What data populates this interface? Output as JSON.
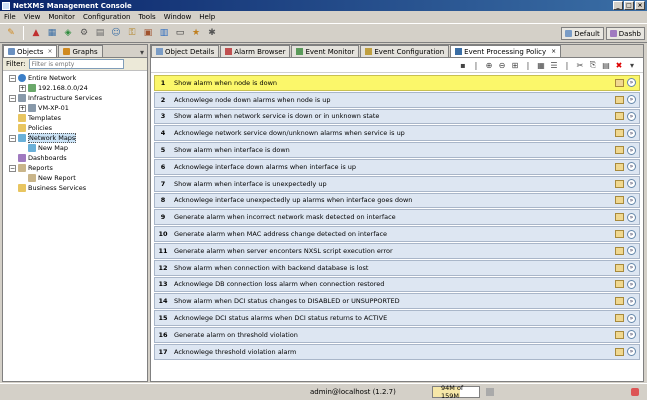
{
  "window": {
    "title": "NetXMS Management Console"
  },
  "menu": [
    "File",
    "View",
    "Monitor",
    "Configuration",
    "Tools",
    "Window",
    "Help"
  ],
  "perspectives": {
    "default_label": "Default",
    "dashboard_label": "Dashb"
  },
  "left_panel": {
    "tabs": [
      {
        "label": "Objects"
      },
      {
        "label": "Graphs"
      }
    ],
    "filter_label": "Filter:",
    "filter_placeholder": "Filter is empty",
    "tree": [
      {
        "label": "Entire Network",
        "level": 0,
        "icon": "globe-icon",
        "expander": "−"
      },
      {
        "label": "192.168.0.0/24",
        "level": 1,
        "icon": "subnet-icon",
        "expander": "+"
      },
      {
        "label": "Infrastructure Services",
        "level": 0,
        "icon": "server-icon",
        "expander": "−"
      },
      {
        "label": "VM-XP-01",
        "level": 1,
        "icon": "node-icon",
        "expander": "+"
      },
      {
        "label": "Templates",
        "level": 0,
        "icon": "folder-icon",
        "expander": ""
      },
      {
        "label": "Policies",
        "level": 0,
        "icon": "folder-icon",
        "expander": ""
      },
      {
        "label": "Network Maps",
        "level": 0,
        "icon": "map-icon",
        "expander": "−"
      },
      {
        "label": "New Map",
        "level": 1,
        "icon": "map-icon",
        "expander": ""
      },
      {
        "label": "Dashboards",
        "level": 0,
        "icon": "dashboard-icon",
        "expander": ""
      },
      {
        "label": "Reports",
        "level": 0,
        "icon": "report-icon",
        "expander": "−"
      },
      {
        "label": "New Report",
        "level": 1,
        "icon": "report-icon",
        "expander": ""
      },
      {
        "label": "Business Services",
        "level": 0,
        "icon": "folder-icon",
        "expander": ""
      }
    ]
  },
  "right_panel": {
    "tabs": [
      {
        "label": "Object Details"
      },
      {
        "label": "Alarm Browser"
      },
      {
        "label": "Event Monitor"
      },
      {
        "label": "Event Configuration"
      },
      {
        "label": "Event Processing Policy"
      }
    ],
    "rules": [
      {
        "num": "1",
        "text": "Show alarm when node is down"
      },
      {
        "num": "2",
        "text": "Acknowlege node down alarms when node is up"
      },
      {
        "num": "3",
        "text": "Show alarm when network service is down or in unknown state"
      },
      {
        "num": "4",
        "text": "Acknowlege network service down/unknown alarms when service is up"
      },
      {
        "num": "5",
        "text": "Show alarm when interface is down"
      },
      {
        "num": "6",
        "text": "Acknowlege interface down alarms when interface is up"
      },
      {
        "num": "7",
        "text": "Show alarm when interface is unexpectedly up"
      },
      {
        "num": "8",
        "text": "Acknowlege interface unexpectedly up alarms when interface goes down"
      },
      {
        "num": "9",
        "text": "Generate alarm when incorrect network mask detected on interface"
      },
      {
        "num": "10",
        "text": "Generate alarm when MAC address change detected on interface"
      },
      {
        "num": "11",
        "text": "Generate alarm when server enconters NXSL script execution error"
      },
      {
        "num": "12",
        "text": "Show alarm when connection with backend database is lost"
      },
      {
        "num": "13",
        "text": "Acknowlege DB connection loss alarm when connection restored"
      },
      {
        "num": "14",
        "text": "Show alarm when DCI status changes to DISABLED or UNSUPPORTED"
      },
      {
        "num": "15",
        "text": "Acknowlege DCI status alarms when DCI status returns to ACTIVE"
      },
      {
        "num": "16",
        "text": "Generate alarm on threshold violation"
      },
      {
        "num": "17",
        "text": "Acknowlege threshold violation alarm"
      }
    ]
  },
  "status": {
    "user": "admin@localhost (1.2.7)",
    "memory_text": "94M of 159M",
    "memory_fraction": 0.59
  },
  "colors": {
    "highlight": "#fbf76a",
    "row": "#dde6f2"
  }
}
